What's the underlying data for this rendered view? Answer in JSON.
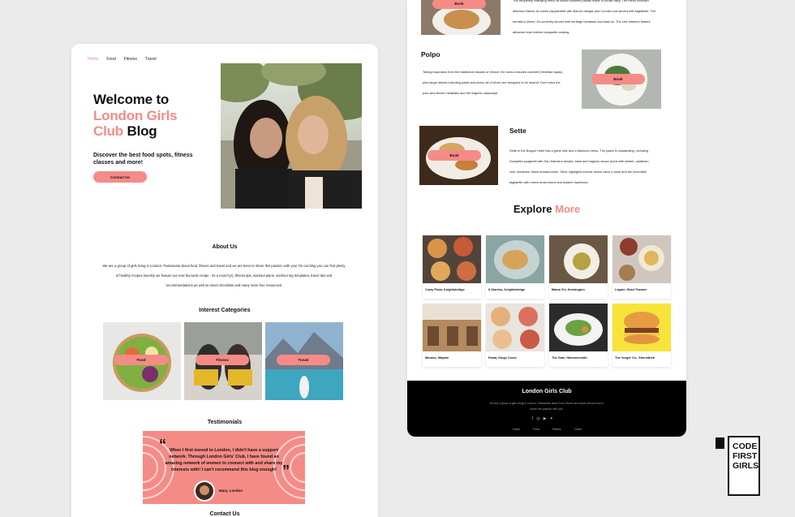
{
  "blog": {
    "nav": [
      "Home",
      "Food",
      "Fitness",
      "Travel"
    ],
    "hero": {
      "title_line1": "Welcome to",
      "title_pink": "London Girls",
      "title_pink2": "Club",
      "title_end": "Blog",
      "subtitle": "Discover the best food spots, fitness classes and more!",
      "button": "Contact Us"
    },
    "about": {
      "title": "About Us",
      "text": "We are a group of girls living in London. Passionate about food, fitness and travel and we are keen to share this passion with you! On our blog you can find plenty of healthy recipes (weekly we feature our new favourite recipe - its a must try!), fitness tips, workout plans, workout log templates, travel tips and recommendations as well as travel checklists and many more free resources!"
    },
    "categories": {
      "title": "Interest Categories",
      "items": [
        "Food",
        "Fitness",
        "Travel"
      ]
    },
    "testimonials": {
      "title": "Testimonials",
      "quote": "When I first moved to London, I didn't have a support network. Through London Girls' Club, I have found an amazing network of women to connect with and share my interests with! I can't recommend this blog enough!",
      "name": "Mary, London"
    },
    "contact_title": "Contact Us"
  },
  "food_page": {
    "top_button": "Book",
    "top_text": "The frequently changing menu at Barolo features pastas made in-house daily. The menu included delicious Barolo as cheek pappardelle with Barolo vinegar and Cornish cod served with tagliatelle. The burrata is divine, it's currently served with heritage tomatoes and basil oil. The chic interiors feature attractive blue leather banquette seating.",
    "polpo": {
      "title": "Polpo",
      "text": "Taking inspiration from the traditional bàcaris of Venice, the menu includes cicchetti (Venetian tapas) plus larger dishes including pasta and pizza, all of which are designed to be shared. Don't miss the pork-and-fennel meatballs and the linguine cassoulpe.",
      "button": "Book"
    },
    "sette": {
      "title": "Sette",
      "text": "Sette in the Bulgari Hotel has a great vibe and a fabulous menu. The pasta is outstanding, including Scarpetta spaghetti with San Marzano tomato, basil and bagnolo sauce pizza with lobster, calabrian chili, tomatoes, black breadcrumbs. Other highlights include ravioli cacio e pepe and the incredible tagliatelle with mixed mushrooms and toasted hazelnuts.",
      "button": "Book"
    },
    "explore": {
      "title_main": "Explore",
      "title_pink": "More",
      "cards": [
        "Crazy Pizza, Knightsbridge",
        "Il Gianino, Knightsbridge",
        "Mama G's, Kensington",
        "Legare, Shad Thames",
        "Murano, Mayfair",
        "Pasta, Kings Cross",
        "The Gate, Hammersmith",
        "The Vurger Co., Shoreditch"
      ]
    },
    "footer": {
      "title": "London Girls Club",
      "text": "We are a group of girls living in London. Passionate about food, fitness and travel and we love to share this passion with you!",
      "social_icons": [
        "facebook-icon",
        "instagram-icon",
        "youtube-icon",
        "twitter-icon"
      ],
      "nav": [
        "Home",
        "Food",
        "Fitness",
        "Travel"
      ]
    }
  },
  "logo": {
    "line1": "CODE",
    "line2": "FIRST",
    "line3": "GIRLS"
  },
  "colors": {
    "accent": "#f58b86",
    "background": "#ebebeb",
    "footer": "#000000"
  }
}
